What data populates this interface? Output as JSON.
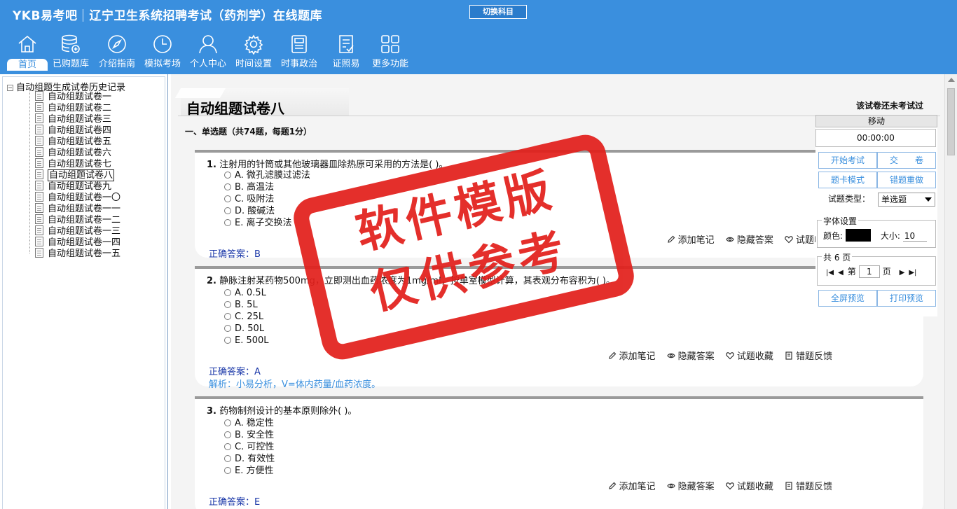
{
  "header": {
    "brand": "YKB易考吧",
    "app_title": "辽宁卫生系统招聘考试（药剂学）在线题库",
    "switch_label": "切换科目",
    "nav": [
      {
        "label": "首页",
        "icon": "home-icon"
      },
      {
        "label": "已购题库",
        "icon": "database-icon"
      },
      {
        "label": "介绍指南",
        "icon": "compass-icon"
      },
      {
        "label": "模拟考场",
        "icon": "clock-icon"
      },
      {
        "label": "个人中心",
        "icon": "user-icon"
      },
      {
        "label": "时间设置",
        "icon": "gear-icon"
      },
      {
        "label": "时事政治",
        "icon": "news-icon"
      },
      {
        "label": "证照易",
        "icon": "certificate-icon"
      },
      {
        "label": "更多功能",
        "icon": "grid-icon"
      }
    ]
  },
  "tree": {
    "root": "自动组题生成试卷历史记录",
    "items": [
      "自动组题试卷一",
      "自动组题试卷二",
      "自动组题试卷三",
      "自动组题试卷四",
      "自动组题试卷五",
      "自动组题试卷六",
      "自动组题试卷七",
      "自动组题试卷八",
      "自动组题试卷九",
      "自动组题试卷一〇",
      "自动组题试卷一一",
      "自动组题试卷一二",
      "自动组题试卷一三",
      "自动组题试卷一四",
      "自动组题试卷一五"
    ],
    "selected_index": 7
  },
  "paper": {
    "title": "自动组题试卷八",
    "status": "该试卷还未考试过",
    "section": "一、单选题（共74题，每题1分）"
  },
  "actions": {
    "note": "添加笔记",
    "hide": "隐藏答案",
    "fav": "试题收藏",
    "report": "错题反馈"
  },
  "questions": [
    {
      "num": "1.",
      "stem": "注射用的针筒或其他玻璃器皿除热原可采用的方法是( )。",
      "options": [
        "A. 微孔滤膜过滤法",
        "B. 高温法",
        "C. 吸附法",
        "D. 酸碱法",
        "E. 离子交换法"
      ],
      "answer": "正确答案：B",
      "analysis": ""
    },
    {
      "num": "2.",
      "stem": "静脉注射某药物500mg，立即测出血药浓度为1mg/ml，按单室模型计算，其表观分布容积为( )。",
      "options": [
        "A. 0.5L",
        "B. 5L",
        "C. 25L",
        "D. 50L",
        "E. 500L"
      ],
      "answer": "正确答案：A",
      "analysis": "解析：小易分析，V=体内药量/血药浓度。"
    },
    {
      "num": "3.",
      "stem": "药物制剂设计的基本原则除外( )。",
      "options": [
        "A. 稳定性",
        "B. 安全性",
        "C. 可控性",
        "D. 有效性",
        "E. 方便性"
      ],
      "answer": "正确答案：E",
      "analysis": ""
    }
  ],
  "panel": {
    "move": "移动",
    "timer": "00:00:00",
    "start": "开始考试",
    "submit": "交　　卷",
    "card_mode": "题卡模式",
    "redo": "错题重做",
    "type_label": "试题类型：",
    "type_value": "单选题",
    "font_legend": "字体设置",
    "color_label": "颜色:",
    "size_label": "大小:",
    "size_value": "10",
    "pages_legend": "共 6 页",
    "page_prefix": "第",
    "page_value": "1",
    "page_suffix": "页",
    "fullscreen": "全屏预览",
    "print": "打印预览"
  },
  "watermark": {
    "line1": "软件模版",
    "line2": "仅供参考",
    "color": "#e2201c"
  },
  "colors": {
    "header_bg": "#3a8fde",
    "answer": "#1a37a8",
    "analysis": "#3a8fde"
  }
}
